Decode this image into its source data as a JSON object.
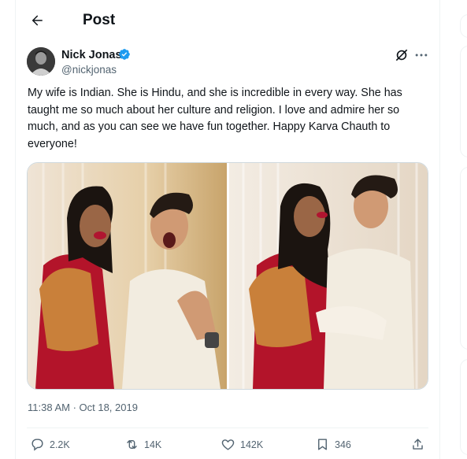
{
  "header": {
    "title": "Post"
  },
  "author": {
    "name": "Nick Jonas",
    "handle": "@nickjonas"
  },
  "tweet": {
    "text": "My wife is Indian. She is Hindu, and she is incredible in every way. She has taught me so much about her culture and religion. I love and admire her so much, and as you can see we have fun together. Happy Karva Chauth to everyone!",
    "timestamp": "11:38 AM · Oct 18, 2019"
  },
  "actions": {
    "replies": "2.2K",
    "reposts": "14K",
    "likes": "142K",
    "bookmarks": "346"
  },
  "colors": {
    "verified": "#1d9bf0",
    "muted": "#536471",
    "border": "#eff3f4"
  },
  "icons": [
    "back-arrow-icon",
    "verified-badge-icon",
    "grok-icon",
    "more-icon",
    "reply-icon",
    "repost-icon",
    "like-icon",
    "bookmark-icon",
    "share-icon"
  ]
}
